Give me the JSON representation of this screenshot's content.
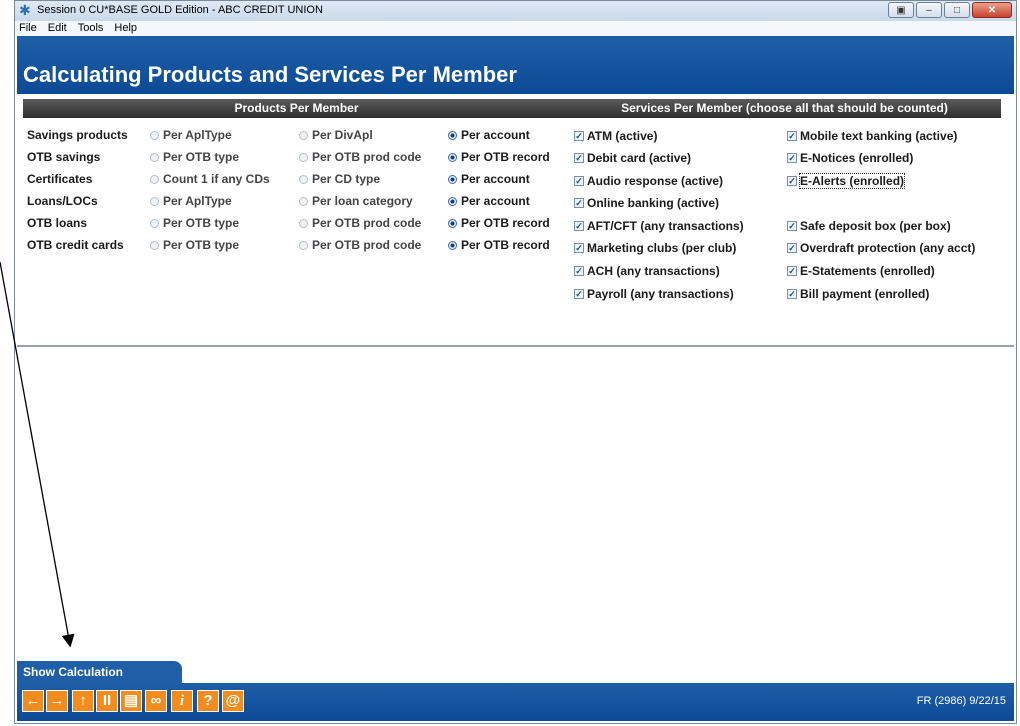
{
  "window": {
    "title": "Session 0 CU*BASE GOLD Edition - ABC CREDIT UNION",
    "app_icon": "asterisk-icon",
    "controls": [
      "restore-icon",
      "minimize-icon",
      "maximize-icon",
      "close-icon"
    ]
  },
  "menu": [
    "File",
    "Edit",
    "Tools",
    "Help"
  ],
  "header": {
    "title": "Calculating Products and Services Per Member"
  },
  "products": {
    "heading": "Products Per Member",
    "rows": [
      {
        "label": "Savings products",
        "opts": [
          "Per AplType",
          "Per DivApl",
          "Per account"
        ],
        "selected": 2
      },
      {
        "label": "OTB savings",
        "opts": [
          "Per OTB type",
          "Per OTB prod code",
          "Per OTB record"
        ],
        "selected": 2
      },
      {
        "label": "Certificates",
        "opts": [
          "Count 1 if any CDs",
          "Per CD type",
          "Per account"
        ],
        "selected": 2
      },
      {
        "label": "Loans/LOCs",
        "opts": [
          "Per AplType",
          "Per loan category",
          "Per account"
        ],
        "selected": 2
      },
      {
        "label": "OTB loans",
        "opts": [
          "Per OTB type",
          "Per OTB prod code",
          "Per OTB record"
        ],
        "selected": 2
      },
      {
        "label": "OTB credit cards",
        "opts": [
          "Per OTB type",
          "Per OTB prod code",
          "Per OTB record"
        ],
        "selected": 2
      }
    ]
  },
  "services": {
    "heading": "Services Per Member (choose all that should be counted)",
    "left": [
      "ATM (active)",
      "Debit card (active)",
      "Audio response (active)",
      "Online banking (active)",
      "AFT/CFT (any transactions)",
      "Marketing clubs (per club)",
      "ACH (any transactions)",
      "Payroll (any transactions)"
    ],
    "right": [
      "Mobile text banking (active)",
      "E-Notices (enrolled)",
      "E-Alerts (enrolled)",
      "Safe deposit box (per box)",
      "Overdraft protection (any acct)",
      "E-Statements (enrolled)",
      "Bill payment (enrolled)"
    ],
    "checked": true
  },
  "tab": {
    "label": "Show Calculation"
  },
  "footer": {
    "buttons": [
      "back-arrow-icon",
      "forward-arrow-icon",
      "up-arrow-icon",
      "pause-icon",
      "print-icon",
      "link-icon",
      "info-icon",
      "help-icon",
      "email-icon"
    ],
    "glyphs": [
      "←",
      "→",
      "↑",
      "II",
      "▤",
      "∞",
      "i",
      "?",
      "@"
    ],
    "status": "FR (2986) 9/22/15"
  },
  "colors": {
    "header": "#1f5fa8",
    "button": "#f28c1c",
    "section": "#3a3a3a"
  }
}
